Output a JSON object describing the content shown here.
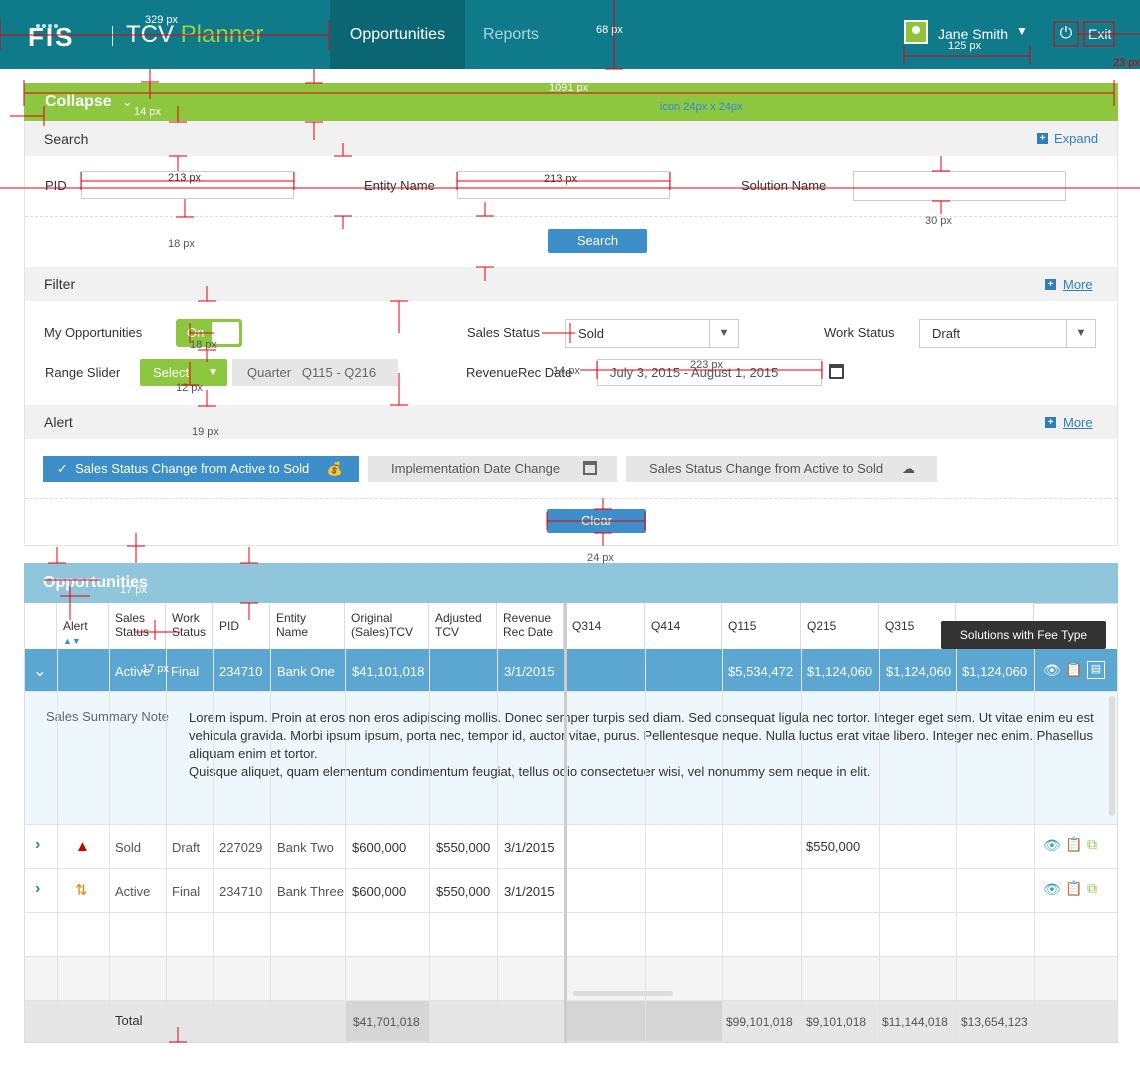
{
  "header": {
    "logo": "FIS",
    "brand_a": "TCV",
    "brand_b": "Planner",
    "nav": [
      "Opportunities",
      "Reports"
    ],
    "user": "Jane Smith",
    "exit": "Exit"
  },
  "collapse": {
    "label": "Collapse"
  },
  "search": {
    "title": "Search",
    "expand": "Expand",
    "pid_label": "PID",
    "entity_label": "Entity Name",
    "solution_label": "Solution Name",
    "button": "Search"
  },
  "filter": {
    "title": "Filter",
    "more": "More",
    "my_opps_label": "My Opportunities",
    "toggle": "On",
    "sales_status_label": "Sales Status",
    "sales_status_value": "Sold",
    "work_status_label": "Work Status",
    "work_status_value": "Draft",
    "range_label": "Range Slider",
    "range_select": "Select",
    "quarter_label": "Quarter",
    "quarter_value": "Q115 - Q216",
    "revrec_label": "RevenueRec Date",
    "revrec_value": "July 3, 2015 - August 1, 2015"
  },
  "alert": {
    "title": "Alert",
    "more": "More",
    "chips": [
      "Sales Status Change from Active to Sold",
      "Implementation Date Change",
      "Sales Status Change from Active to Sold"
    ],
    "clear": "Clear"
  },
  "table": {
    "title": "Opportunities",
    "columns": [
      "Alert",
      "Sales Status",
      "Work Status",
      "PID",
      "Entity Name",
      "Original (Sales)TCV",
      "Adjusted TCV",
      "Revenue Rec Date",
      "Q314",
      "Q414",
      "Q115",
      "Q215",
      "Q315"
    ],
    "tooltip": "Solutions with Fee Type",
    "rows": [
      {
        "status": "Active",
        "work": "Final",
        "pid": "234710",
        "entity": "Bank One",
        "orig": "$41,101,018",
        "adj": "",
        "rev": "3/1/2015",
        "q314": "",
        "q414": "",
        "q115": "$5,534,472",
        "q215": "$1,124,060",
        "q315": "$1,124,060",
        "q415": "$1,124,060"
      },
      {
        "status": "Sold",
        "work": "Draft",
        "pid": "227029",
        "entity": "Bank Two",
        "orig": "$600,000",
        "adj": "$550,000",
        "rev": "3/1/2015",
        "q314": "",
        "q414": "",
        "q115": "",
        "q215": "$550,000",
        "q315": "",
        "q415": ""
      },
      {
        "status": "Active",
        "work": "Final",
        "pid": "234710",
        "entity": "Bank Three",
        "orig": "$600,000",
        "adj": "$550,000",
        "rev": "3/1/2015",
        "q314": "",
        "q414": "",
        "q115": "",
        "q215": "",
        "q315": "",
        "q415": ""
      }
    ],
    "note_label": "Sales Summary Note",
    "note_text_1": "Lorem ispum. Proin at eros non eros adipiscing mollis. Donec semper turpis sed diam. Sed consequat ligula nec tortor. Integer eget sem. Ut vitae enim eu est vehicula gravida. Morbi ipsum ipsum, porta nec, tempor id, auctor vitae, purus. Pellentesque neque. Nulla luctus erat vitae libero. Integer nec enim. Phasellus aliquam enim et tortor.",
    "note_text_2": "Quisque aliquet, quam elementum condimentum feugiat, tellus odio consectetuer wisi, vel nonummy sem neque in elit.",
    "total_label": "Total",
    "totals": {
      "orig": "$41,701,018",
      "q115": "$99,101,018",
      "q215": "$9,101,018",
      "q315": "$11,144,018",
      "q415": "$13,654,123"
    }
  },
  "annotations": [
    "329 px",
    "68 px",
    "125 px",
    "23 px",
    "1091 px",
    "icon 24px  x  24px",
    "14 px",
    "213 px",
    "213 px",
    "18 px",
    "30 px",
    "18 px",
    "223 px",
    "12 px",
    "19 px",
    "14 px",
    "24 px",
    "17 px",
    "17 px"
  ],
  "colors": {
    "header": "#0f7a8a",
    "green": "#8dc63f",
    "blue": "#3d8ec9",
    "table_head": "#8fc6dc",
    "selected_row": "#5ba7d1",
    "annot": "#e3000f"
  }
}
